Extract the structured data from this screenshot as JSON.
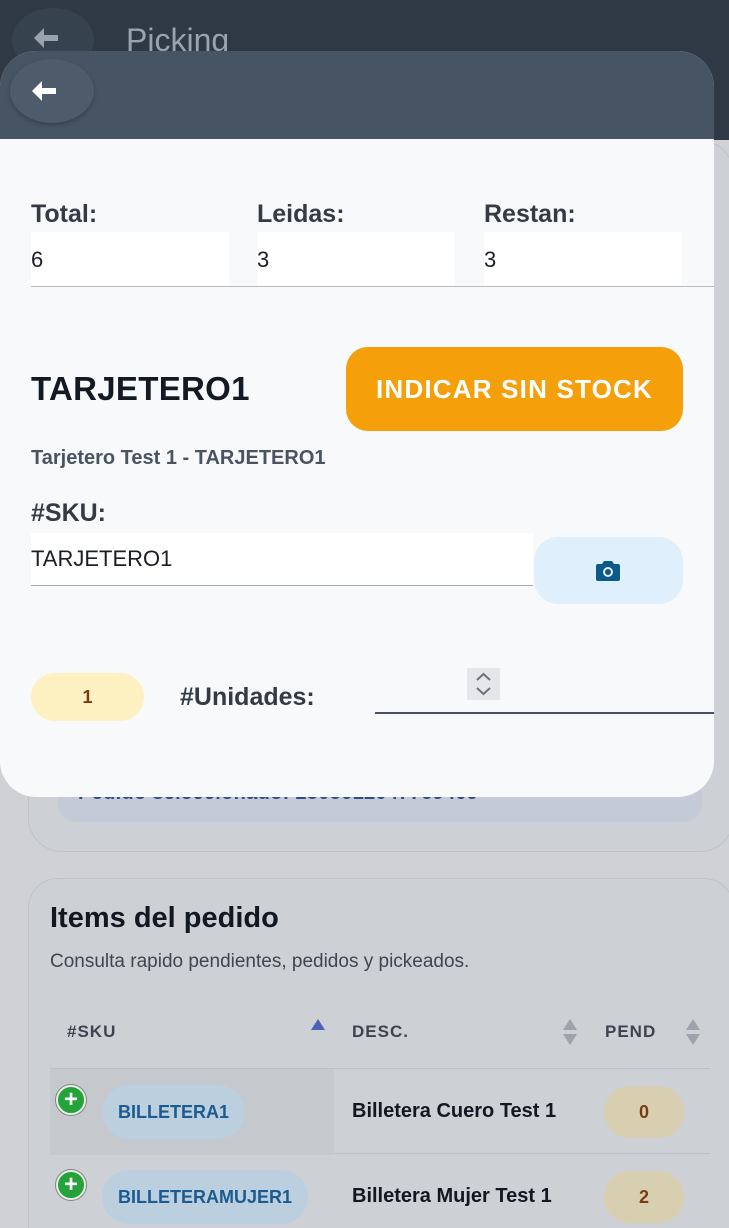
{
  "background": {
    "title": "Picking",
    "selected_order_text": "Pedido seleccionado: 2505012047769409",
    "items_card": {
      "title": "Items del pedido",
      "subtitle": "Consulta rapido pendientes, pedidos y pickeados.",
      "columns": [
        "#SKU",
        "DESC.",
        "PEND"
      ],
      "rows": [
        {
          "sku": "BILLETERA1",
          "desc": "Billetera Cuero Test 1",
          "pend": "0"
        },
        {
          "sku": "BILLETERAMUJER1",
          "desc": "Billetera Mujer Test 1",
          "pend": "2"
        }
      ]
    }
  },
  "modal": {
    "stats": {
      "total_label": "Total:",
      "total_value": "6",
      "read_label": "Leidas:",
      "read_value": "3",
      "remaining_label": "Restan:",
      "remaining_value": "3"
    },
    "product_code": "TARJETERO1",
    "no_stock_button": "INDICAR SIN STOCK",
    "product_description": "Tarjetero Test 1 - TARJETERO1",
    "sku_label": "#SKU:",
    "sku_value": "TARJETERO1",
    "quantity_badge": "1",
    "units_label": "#Unidades:",
    "units_value": ""
  },
  "colors": {
    "accent_orange": "#f59f0b",
    "header_dark": "#475463",
    "camera_icon": "#0b5a8a"
  },
  "icons": [
    "back-arrow-icon",
    "camera-icon",
    "plus-circle-icon",
    "sort-asc-icon",
    "sort-icon",
    "spinner-icon"
  ]
}
